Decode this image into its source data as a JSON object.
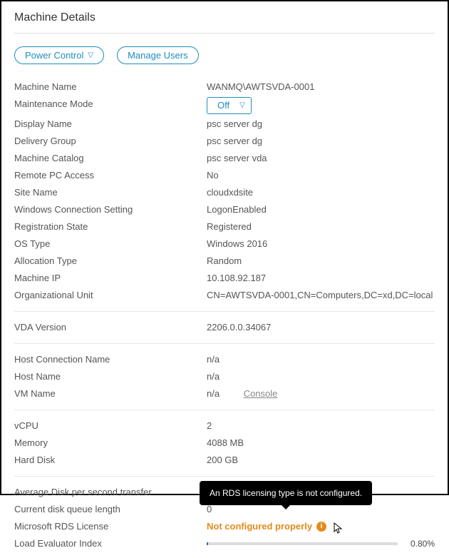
{
  "title": "Machine Details",
  "actions": {
    "power_control": "Power Control",
    "manage_users": "Manage Users"
  },
  "maintenance_mode_value": "Off",
  "fields": {
    "machine_name": {
      "label": "Machine Name",
      "value": "WANMQ\\AWTSVDA-0001"
    },
    "maintenance_mode": {
      "label": "Maintenance Mode"
    },
    "display_name": {
      "label": "Display Name",
      "value": "psc server dg"
    },
    "delivery_group": {
      "label": "Delivery Group",
      "value": "psc server dg"
    },
    "machine_catalog": {
      "label": "Machine Catalog",
      "value": "psc server vda"
    },
    "remote_pc": {
      "label": "Remote PC Access",
      "value": "No"
    },
    "site_name": {
      "label": "Site Name",
      "value": "cloudxdsite"
    },
    "win_conn": {
      "label": "Windows Connection Setting",
      "value": "LogonEnabled"
    },
    "reg_state": {
      "label": "Registration State",
      "value": "Registered"
    },
    "os_type": {
      "label": "OS Type",
      "value": "Windows 2016"
    },
    "alloc_type": {
      "label": "Allocation Type",
      "value": "Random"
    },
    "machine_ip": {
      "label": "Machine IP",
      "value": "10.108.92.187"
    },
    "ou": {
      "label": "Organizational Unit",
      "value": "CN=AWTSVDA-0001,CN=Computers,DC=xd,DC=local"
    },
    "vda_version": {
      "label": "VDA Version",
      "value": "2206.0.0.34067"
    },
    "host_conn": {
      "label": "Host Connection Name",
      "value": "n/a"
    },
    "host_name": {
      "label": "Host Name",
      "value": "n/a"
    },
    "vm_name": {
      "label": "VM Name",
      "value": "n/a"
    },
    "console_link": "Console",
    "vcpu": {
      "label": "vCPU",
      "value": "2"
    },
    "memory": {
      "label": "Memory",
      "value": "4088 MB"
    },
    "hard_disk": {
      "label": "Hard Disk",
      "value": "200 GB"
    },
    "avg_disk": {
      "label": "Average Disk per second transfer",
      "value": ""
    },
    "disk_queue": {
      "label": "Current disk queue length",
      "value": "0"
    },
    "rds": {
      "label": "Microsoft RDS License",
      "value": "Not configured properly"
    },
    "lei": {
      "label": "Load Evaluator Index",
      "pct": "0.80%",
      "fill_pct": 0.8
    }
  },
  "tooltip": "An RDS licensing type is not configured."
}
